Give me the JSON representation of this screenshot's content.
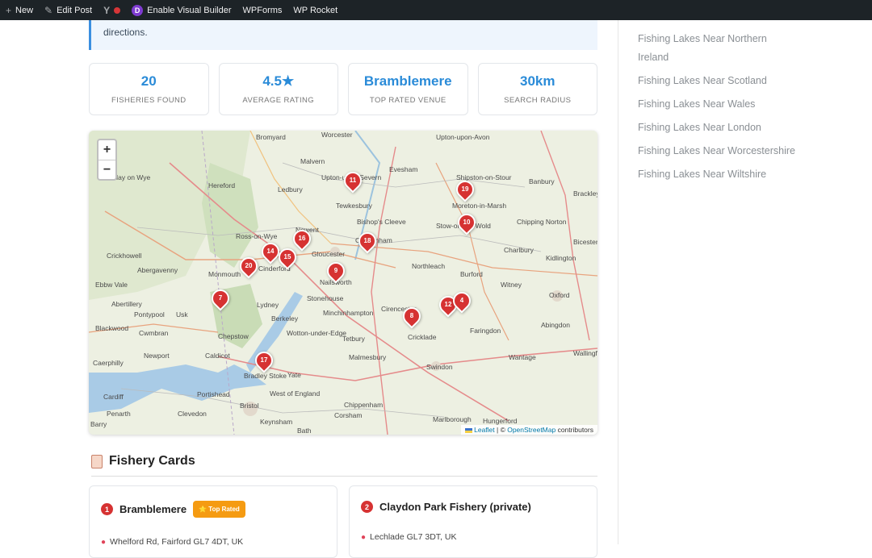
{
  "admin_bar": {
    "new": "New",
    "edit_post": "Edit Post",
    "divi_letter": "D",
    "visual_builder": "Enable Visual Builder",
    "wpforms": "WPForms",
    "wprocket": "WP Rocket"
  },
  "notice": {
    "text": "directions."
  },
  "stats": [
    {
      "value": "20",
      "label": "FISHERIES FOUND"
    },
    {
      "value": "4.5★",
      "label": "AVERAGE RATING"
    },
    {
      "value": "Bramblemere",
      "label": "TOP RATED VENUE"
    },
    {
      "value": "30km",
      "label": "SEARCH RADIUS"
    }
  ],
  "map": {
    "zoom_in": "+",
    "zoom_out": "−",
    "attribution_leaflet": "Leaflet",
    "attribution_sep": " | © ",
    "attribution_osm": "OpenStreetMap",
    "attribution_tail": " contributors",
    "place_labels": [
      "Bromyard",
      "Worcester",
      "Upton-upon-Avon",
      "Hay on Wye",
      "Hereford",
      "Malvern",
      "Evesham",
      "Shipston-on-Stour",
      "Banbury",
      "Brackley",
      "Ledbury",
      "Upton-upon-Severn",
      "Tewkesbury",
      "Moreton-in-Marsh",
      "Bishop's Cleeve",
      "Newent",
      "Ross-on-Wye",
      "Cheltenham",
      "Stow-on-the-Wold",
      "Bicester",
      "Crickhowell",
      "Abergavenny",
      "Monmouth",
      "Cinderford",
      "Gloucester",
      "Chipping Norton",
      "Charlbury",
      "Kidlington",
      "Northleach",
      "Ebbw Vale",
      "Nailsworth",
      "Burford",
      "Witney",
      "Abertillery",
      "Pontypool",
      "Usk",
      "Lydney",
      "Stonehouse",
      "Oxford",
      "Minchinhampton",
      "Cirencester",
      "Blackwood",
      "Cwmbran",
      "Berkeley",
      "Wotton-under-Edge",
      "Tetbury",
      "Cricklade",
      "Faringdon",
      "Abingdon",
      "Chepstow",
      "Newport",
      "Caldicot",
      "Malmesbury",
      "Wantage",
      "Wallingford",
      "Caerphilly",
      "Swindon",
      "Bradley Stoke",
      "Yate",
      "Cardiff",
      "Portishead",
      "West of England",
      "Chippenham",
      "Penarth",
      "Bristol",
      "Clevedon",
      "Corsham",
      "Barry",
      "Keynsham",
      "Bath",
      "Marlborough",
      "Hungerford"
    ],
    "markers": [
      "11",
      "19",
      "10",
      "16",
      "18",
      "14",
      "15",
      "20",
      "9",
      "7",
      "12",
      "4",
      "8",
      "17"
    ]
  },
  "section": {
    "title": "Fishery Cards"
  },
  "cards": [
    {
      "number": "1",
      "name": "Bramblemere",
      "badge": "⭐ Top Rated",
      "address": "Whelford Rd, Fairford GL7 4DT, UK"
    },
    {
      "number": "2",
      "name": "Claydon Park Fishery (private)",
      "address": "Lechlade GL7 3DT, UK"
    }
  ],
  "sidebar": {
    "links": [
      "Fishing Lakes Near Northern Ireland",
      "Fishing Lakes Near Scotland",
      "Fishing Lakes Near Wales",
      "Fishing Lakes Near London",
      "Fishing Lakes Near Worcestershire",
      "Fishing Lakes Near Wiltshire"
    ]
  },
  "colors": {
    "accent": "#2a8bd8",
    "marker": "#d63232",
    "badge": "#f59b12",
    "admin_bar": "#1d2327"
  }
}
